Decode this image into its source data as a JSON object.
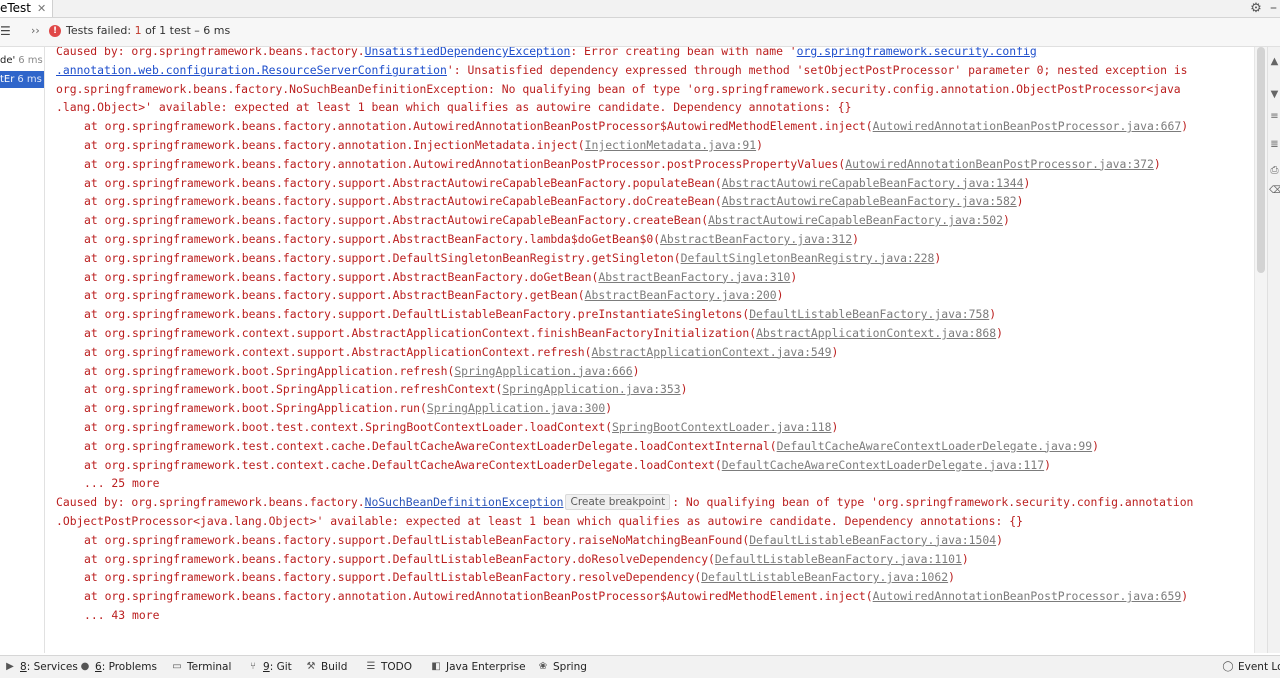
{
  "top_tab": {
    "label": "eTest",
    "close_glyph": "✕",
    "settings_icon": "gear-icon",
    "minimize_glyph": "–"
  },
  "test_bar": {
    "sort_icon": "sort-icon",
    "expand_glyph": "››",
    "fail_icon": "error-icon",
    "status_prefix": "Tests failed: ",
    "status_failed": "1",
    "status_suffix": " of 1 test – 6 ms"
  },
  "tree": {
    "items": [
      {
        "label": "de'",
        "duration": "6 ms"
      },
      {
        "label": "tEr",
        "duration": "6 ms"
      }
    ]
  },
  "console": {
    "partial_top_prefix": "Caused by: org.springframework.beans.factory.",
    "partial_top_link": "UnsatisfiedDependencyException",
    "partial_top_rest": ": Error creating bean with name '",
    "partial_top_link2": "org.springframework.security.config",
    "line1_link": ".annotation.web.configuration.ResourceServerConfiguration",
    "line1_rest": "': Unsatisfied dependency expressed through method 'setObjectPostProcessor' parameter 0; nested exception is",
    "line2": "org.springframework.beans.factory.NoSuchBeanDefinitionException: No qualifying bean of type 'org.springframework.security.config.annotation.ObjectPostProcessor<java",
    "line3": ".lang.Object>' available: expected at least 1 bean which qualifies as autowire candidate. Dependency annotations: {}",
    "frames1": [
      {
        "m": "at org.springframework.beans.factory.annotation.AutowiredAnnotationBeanPostProcessor$AutowiredMethodElement.inject(",
        "s": "AutowiredAnnotationBeanPostProcessor.java:667"
      },
      {
        "m": "at org.springframework.beans.factory.annotation.InjectionMetadata.inject(",
        "s": "InjectionMetadata.java:91"
      },
      {
        "m": "at org.springframework.beans.factory.annotation.AutowiredAnnotationBeanPostProcessor.postProcessPropertyValues(",
        "s": "AutowiredAnnotationBeanPostProcessor.java:372"
      },
      {
        "m": "at org.springframework.beans.factory.support.AbstractAutowireCapableBeanFactory.populateBean(",
        "s": "AbstractAutowireCapableBeanFactory.java:1344"
      },
      {
        "m": "at org.springframework.beans.factory.support.AbstractAutowireCapableBeanFactory.doCreateBean(",
        "s": "AbstractAutowireCapableBeanFactory.java:582"
      },
      {
        "m": "at org.springframework.beans.factory.support.AbstractAutowireCapableBeanFactory.createBean(",
        "s": "AbstractAutowireCapableBeanFactory.java:502"
      },
      {
        "m": "at org.springframework.beans.factory.support.AbstractBeanFactory.lambda$doGetBean$0(",
        "s": "AbstractBeanFactory.java:312"
      },
      {
        "m": "at org.springframework.beans.factory.support.DefaultSingletonBeanRegistry.getSingleton(",
        "s": "DefaultSingletonBeanRegistry.java:228"
      },
      {
        "m": "at org.springframework.beans.factory.support.AbstractBeanFactory.doGetBean(",
        "s": "AbstractBeanFactory.java:310"
      },
      {
        "m": "at org.springframework.beans.factory.support.AbstractBeanFactory.getBean(",
        "s": "AbstractBeanFactory.java:200"
      },
      {
        "m": "at org.springframework.beans.factory.support.DefaultListableBeanFactory.preInstantiateSingletons(",
        "s": "DefaultListableBeanFactory.java:758"
      },
      {
        "m": "at org.springframework.context.support.AbstractApplicationContext.finishBeanFactoryInitialization(",
        "s": "AbstractApplicationContext.java:868"
      },
      {
        "m": "at org.springframework.context.support.AbstractApplicationContext.refresh(",
        "s": "AbstractApplicationContext.java:549"
      },
      {
        "m": "at org.springframework.boot.SpringApplication.refresh(",
        "s": "SpringApplication.java:666"
      },
      {
        "m": "at org.springframework.boot.SpringApplication.refreshContext(",
        "s": "SpringApplication.java:353"
      },
      {
        "m": "at org.springframework.boot.SpringApplication.run(",
        "s": "SpringApplication.java:300"
      },
      {
        "m": "at org.springframework.boot.test.context.SpringBootContextLoader.loadContext(",
        "s": "SpringBootContextLoader.java:118"
      },
      {
        "m": "at org.springframework.test.context.cache.DefaultCacheAwareContextLoaderDelegate.loadContextInternal(",
        "s": "DefaultCacheAwareContextLoaderDelegate.java:99"
      },
      {
        "m": "at org.springframework.test.context.cache.DefaultCacheAwareContextLoaderDelegate.loadContext(",
        "s": "DefaultCacheAwareContextLoaderDelegate.java:117"
      }
    ],
    "more1": "... 25 more",
    "caused_prefix": "Caused by: org.springframework.beans.factory.",
    "caused_link": "NoSuchBeanDefinitionException",
    "tooltip": "Create breakpoint",
    "caused_rest": ": No qualifying bean of type 'org.springframework.security.config.annotation",
    "caused_line2": ".ObjectPostProcessor<java.lang.Object>' available: expected at least 1 bean which qualifies as autowire candidate. Dependency annotations: {}",
    "frames2": [
      {
        "m": "at org.springframework.beans.factory.support.DefaultListableBeanFactory.raiseNoMatchingBeanFound(",
        "s": "DefaultListableBeanFactory.java:1504"
      },
      {
        "m": "at org.springframework.beans.factory.support.DefaultListableBeanFactory.doResolveDependency(",
        "s": "DefaultListableBeanFactory.java:1101"
      },
      {
        "m": "at org.springframework.beans.factory.support.DefaultListableBeanFactory.resolveDependency(",
        "s": "DefaultListableBeanFactory.java:1062"
      },
      {
        "m": "at org.springframework.beans.factory.annotation.AutowiredAnnotationBeanPostProcessor$AutowiredMethodElement.inject(",
        "s": "AutowiredAnnotationBeanPostProcessor.java:659"
      }
    ],
    "more2": "... 43 more",
    "close_paren": ")"
  },
  "bottom_bar": {
    "items": [
      {
        "icon": "services-icon",
        "num": "8",
        "label": ": Services"
      },
      {
        "icon": "problems-icon",
        "num": "6",
        "label": ": Problems"
      },
      {
        "icon": "terminal-icon",
        "num": "",
        "label": "Terminal"
      },
      {
        "icon": "git-icon",
        "num": "9",
        "label": ": Git"
      },
      {
        "icon": "build-icon",
        "num": "",
        "label": "Build"
      },
      {
        "icon": "todo-icon",
        "num": "",
        "label": "TODO"
      },
      {
        "icon": "java-enterprise-icon",
        "num": "",
        "label": "Java Enterprise"
      },
      {
        "icon": "spring-icon",
        "num": "",
        "label": "Spring"
      },
      {
        "icon": "event-log-icon",
        "num": "",
        "label": "Event Lo"
      }
    ]
  },
  "colors": {
    "error_text": "#bb1f1f",
    "link": "#2b55b8",
    "source_link": "#7c7c7c",
    "selection": "#2f65ca"
  }
}
